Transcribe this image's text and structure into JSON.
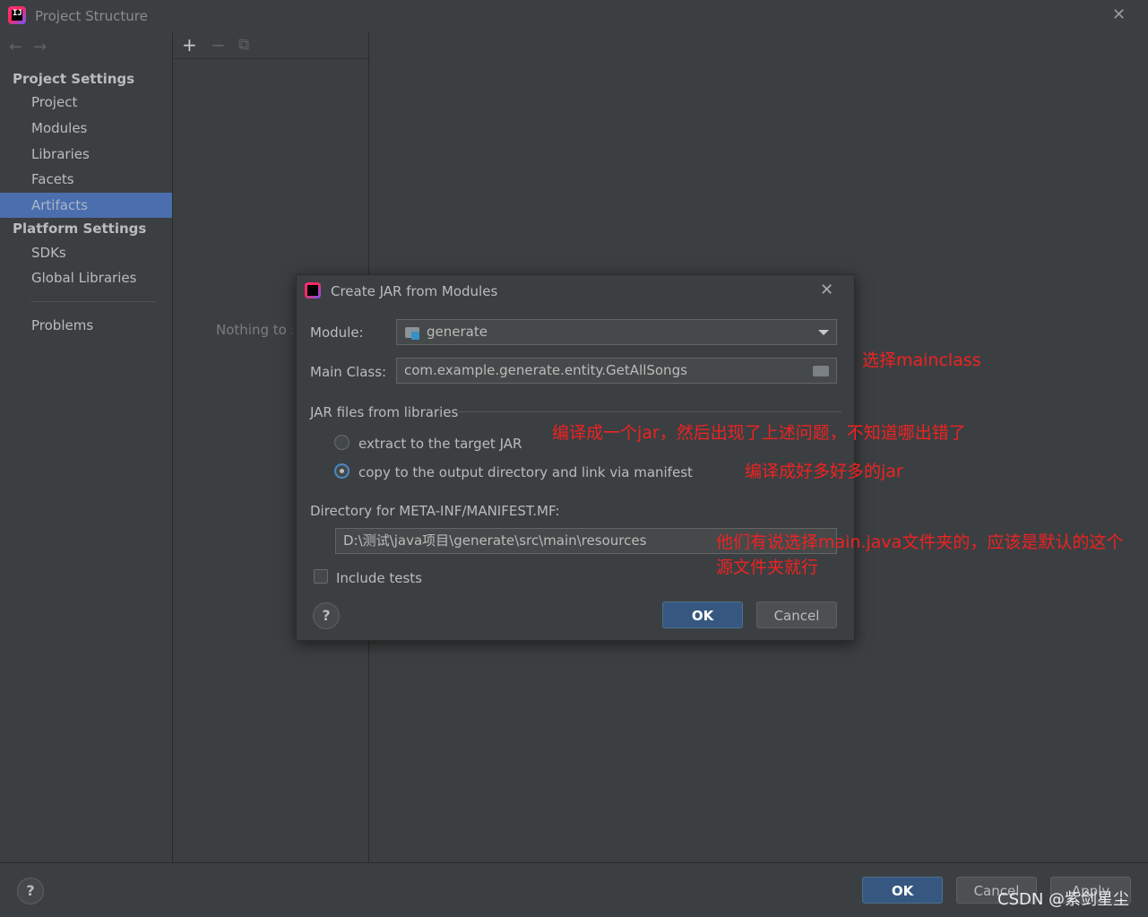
{
  "window": {
    "title": "Project Structure",
    "close_glyph": "✕",
    "app_icon_text": "IJ"
  },
  "sidebar": {
    "back_arrow": "←",
    "forward_arrow": "→",
    "project_settings_header": "Project Settings",
    "items": [
      {
        "label": "Project"
      },
      {
        "label": "Modules"
      },
      {
        "label": "Libraries"
      },
      {
        "label": "Facets"
      },
      {
        "label": "Artifacts",
        "selected": true
      }
    ],
    "platform_settings_header": "Platform Settings",
    "platform_items": [
      {
        "label": "SDKs"
      },
      {
        "label": "Global Libraries"
      }
    ],
    "problems_label": "Problems"
  },
  "toolbar": {
    "add": "+",
    "remove": "−",
    "copy": "⧉"
  },
  "mid_panel": {
    "empty_text": "Nothing to s"
  },
  "dialog": {
    "title": "Create JAR from Modules",
    "close_glyph": "✕",
    "module_label": "Module:",
    "module_value": "generate",
    "main_class_label": "Main Class:",
    "main_class_value": "com.example.generate.entity.GetAllSongs",
    "jar_group_label": "JAR files from libraries",
    "radio_extract_label": "extract to the target JAR",
    "radio_copy_label": "copy to the output directory and link via manifest",
    "radio_selected": "copy",
    "manifest_dir_label": "Directory for META-INF/MANIFEST.MF:",
    "manifest_dir_value": "D:\\测试\\java项目\\generate\\src\\main\\resources",
    "include_tests_label": "Include tests",
    "include_tests_checked": false,
    "help": "?",
    "ok": "OK",
    "cancel": "Cancel"
  },
  "bottom": {
    "help": "?",
    "ok": "OK",
    "cancel": "Cancel",
    "apply": "Apply"
  },
  "annotations": {
    "select_mainclass": "选择mainclass",
    "note_single_jar": "编译成一个jar，然后出现了上述问题，不知道哪出错了",
    "note_many_jars": "编译成好多好多的jar",
    "note_dir_line1": "他们有说选择main.java文件夹的，应该是默认的这个",
    "note_dir_line2": "源文件夹就行"
  },
  "watermark": "CSDN @紫剑星尘",
  "colors": {
    "accent": "#4b6eaf",
    "primary_button": "#365880",
    "annotation_red": "#ee2222"
  }
}
